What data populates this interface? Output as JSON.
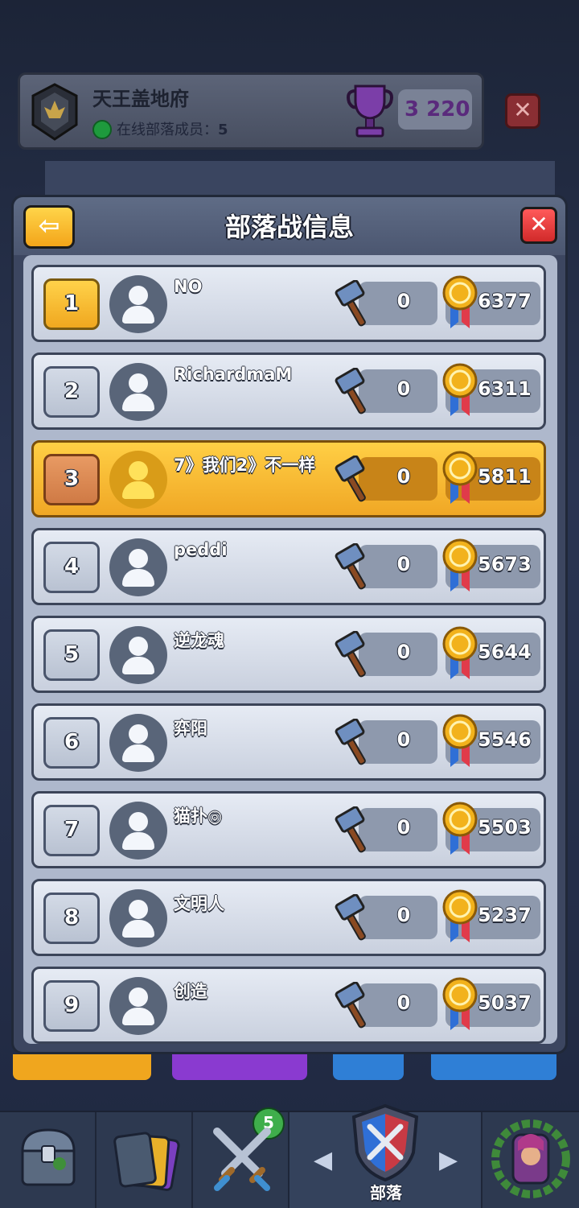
{
  "clan": {
    "name": "天王盖地府",
    "online_label": "在线部落成员：",
    "online_count": "5",
    "trophies": "3 220"
  },
  "modal": {
    "title": "部落战信息",
    "back_icon": "arrow-left",
    "close_icon": "close-x"
  },
  "members": [
    {
      "rank": "1",
      "name": "NO",
      "attacks": "0",
      "score": "6377"
    },
    {
      "rank": "2",
      "name": "RichardmaM",
      "attacks": "0",
      "score": "6311"
    },
    {
      "rank": "3",
      "name": "7》我们2》不一样",
      "attacks": "0",
      "score": "5811"
    },
    {
      "rank": "4",
      "name": "peddi",
      "attacks": "0",
      "score": "5673"
    },
    {
      "rank": "5",
      "name": "逆龙魂",
      "attacks": "0",
      "score": "5644"
    },
    {
      "rank": "6",
      "name": "弈阳",
      "attacks": "0",
      "score": "5546"
    },
    {
      "rank": "7",
      "name": "猫扑◎",
      "attacks": "0",
      "score": "5503"
    },
    {
      "rank": "8",
      "name": "文明人",
      "attacks": "0",
      "score": "5237"
    },
    {
      "rank": "9",
      "name": "创造",
      "attacks": "0",
      "score": "5037"
    }
  ],
  "nav": {
    "cards_badge": "5",
    "clan_label": "部落"
  },
  "colors": {
    "highlight_row": "#f0a725",
    "gold_rank": "#ffd24a",
    "close_red": "#d12a2a"
  }
}
